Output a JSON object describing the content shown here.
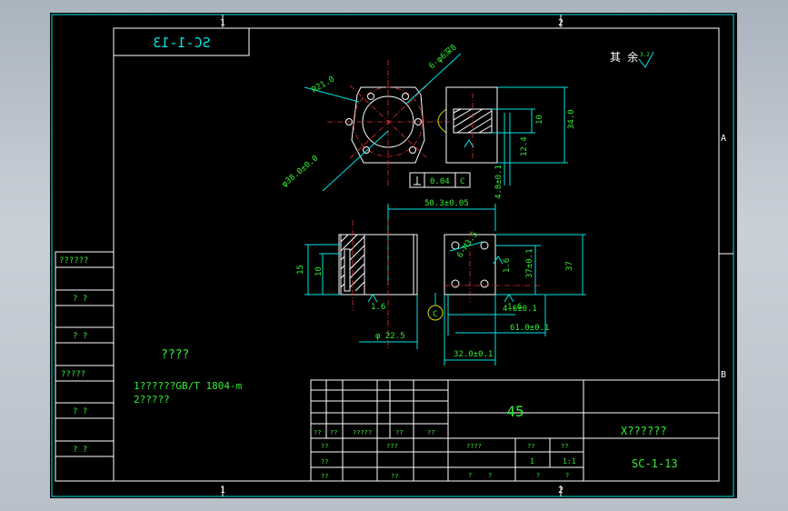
{
  "sheet": {
    "zone_labels": {
      "top_1": "1",
      "top_2": "2",
      "bottom_1": "1",
      "bottom_2": "2",
      "right_a": "A",
      "right_b": "B"
    },
    "mirrored_code": "SC-1-13",
    "roughness": {
      "label": "其 余",
      "value": "3.2"
    }
  },
  "dimensions": {
    "r21": "R21.0",
    "holes": "6-φ6深8",
    "bolt_circle": "φ38.0±0.0",
    "d10": "10",
    "d34": "34.0",
    "d12": "12.4",
    "tol_flat": "0.04",
    "tol_ref": "C",
    "d48": "4.8±0.1",
    "d503": "50.3±0.05",
    "h15": "15",
    "h10": "10",
    "thread": "6-M3.5",
    "d37": "37±0.1",
    "h37": "37",
    "ref_c": "C",
    "d225": "φ 22.5",
    "d46": "4.6±0.1",
    "d61": "61.0±0.1",
    "d32": "32.0±0.1",
    "rough_a": "1.6",
    "rough_b": "1.6",
    "rough_c": "1.6"
  },
  "left_column": [
    "??????",
    "? ?",
    "? ?",
    "?????",
    "? ?",
    "? ?"
  ],
  "notes": {
    "heading": "????",
    "line1": "1??????GB/T 1804-m",
    "line2": "2?????"
  },
  "title_block": {
    "material": "45",
    "name": "X??????",
    "drawing_no": "SC-1-13",
    "row_labels": {
      "a": "??",
      "b": "??",
      "c": "?????",
      "d": "??",
      "e": "??"
    },
    "row2": {
      "a": "??",
      "b": "???"
    },
    "row3": {
      "a": "??"
    },
    "row4": {
      "a": "??",
      "b": "??"
    },
    "scale_head": {
      "a": "????",
      "b": "??",
      "c": "??"
    },
    "scale_vals": {
      "a": "1",
      "b": "1:1"
    },
    "footer": {
      "a": "?",
      "b": "?",
      "c": "?",
      "d": "?"
    }
  }
}
